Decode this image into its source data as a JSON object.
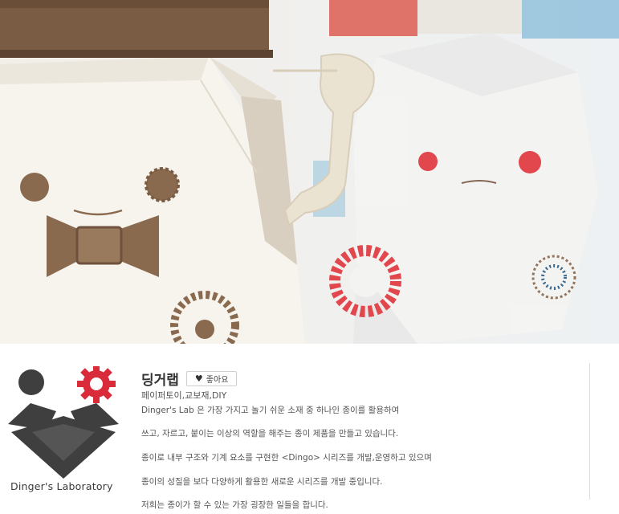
{
  "hero": {
    "image": "paper-robot-photo"
  },
  "profile": {
    "logo_text": "Dinger's Laboratory",
    "name": "딩거랩",
    "like_button": {
      "icon": "heart-icon",
      "label": "좋아요"
    },
    "category": "페이퍼토이,교보재,DIY",
    "description": [
      "Dinger's Lab 은 가장 가지고 놀기 쉬운 소재 중 하나인 종이를 활용하여",
      "쓰고, 자르고, 붙이는 이상의 역할을 해주는 종이 제품을 만들고 있습니다.",
      "종이로 내부 구조와 기계 요소를 구현한 <Dingo> 시리즈를 개발,운영하고 있으며",
      "종이의 성질을 보다 다양하게 활용한 새로운 시리즈를 개발 중입니다.",
      "저희는 종이가 할 수 있는 가장 굉장한 일들을 합니다."
    ]
  },
  "colors": {
    "logo_dark": "#3f3f3f",
    "logo_gear": "#d92b3a",
    "robot_red": "#e0393f",
    "cardboard": "#8a6a4f"
  }
}
